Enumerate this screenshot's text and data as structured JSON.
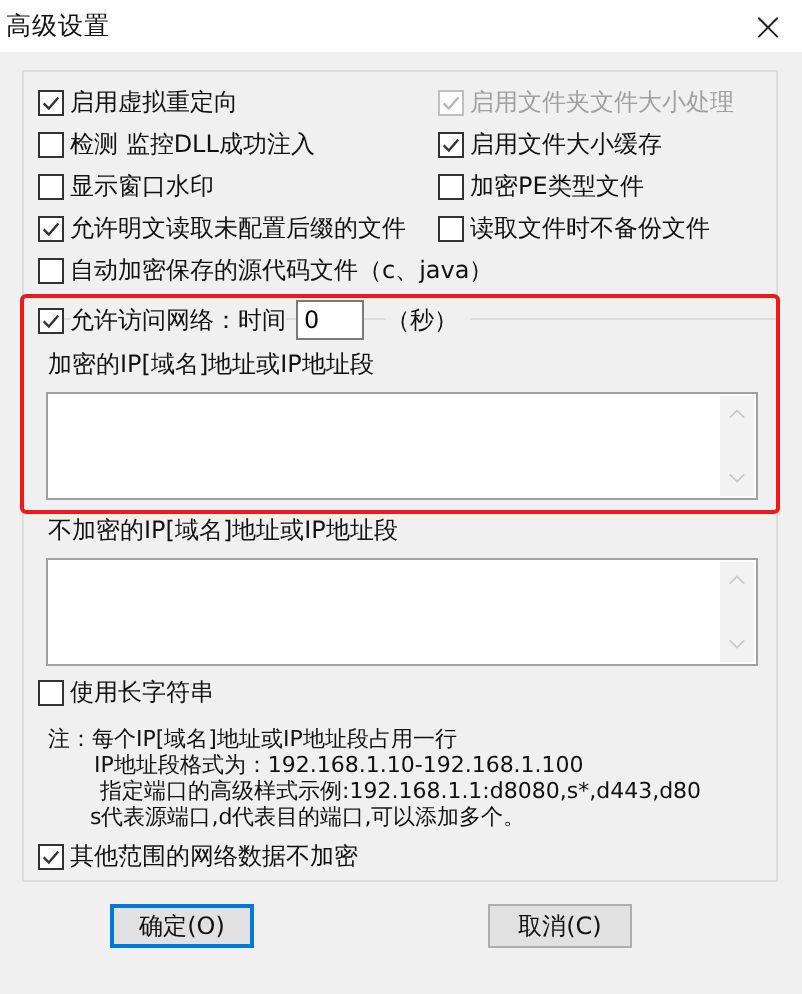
{
  "window": {
    "title": "高级设置",
    "close": "×"
  },
  "options": [
    {
      "label": "启用虚拟重定向",
      "checked": true,
      "disabled": false
    },
    {
      "label": "启用文件夹文件大小处理",
      "checked": true,
      "disabled": true
    },
    {
      "label": "检测 监控DLL成功注入",
      "checked": false,
      "disabled": false
    },
    {
      "label": "启用文件大小缓存",
      "checked": true,
      "disabled": false
    },
    {
      "label": "显示窗口水印",
      "checked": false,
      "disabled": false
    },
    {
      "label": "加密PE类型文件",
      "checked": false,
      "disabled": false
    },
    {
      "label": "允许明文读取未配置后缀的文件",
      "checked": true,
      "disabled": false
    },
    {
      "label": "读取文件时不备份文件",
      "checked": false,
      "disabled": false
    },
    {
      "label": "自动加密保存的源代码文件（c、java）",
      "checked": false,
      "disabled": false
    }
  ],
  "network": {
    "label": "允许访问网络：时间",
    "checked": true,
    "time_value": "0",
    "unit": "（秒）",
    "encrypted_label": "加密的IP[域名]地址或IP地址段",
    "unencrypted_label": "不加密的IP[域名]地址或IP地址段"
  },
  "long_string": {
    "label": "使用长字符串",
    "checked": false
  },
  "note_lines": [
    "注：每个IP[域名]地址或IP地址段占用一行",
    "IP地址段格式为：192.168.1.10-192.168.1.100",
    "指定端口的高级样式示例:192.168.1.1:d8080,s*,d443,d80",
    "s代表源端口,d代表目的端口,可以添加多个。"
  ],
  "other_unencrypted": {
    "label": "其他范围的网络数据不加密",
    "checked": true
  },
  "buttons": [
    {
      "label": "确定(O)",
      "selected": true
    },
    {
      "label": "取消(C)",
      "selected": false
    }
  ]
}
